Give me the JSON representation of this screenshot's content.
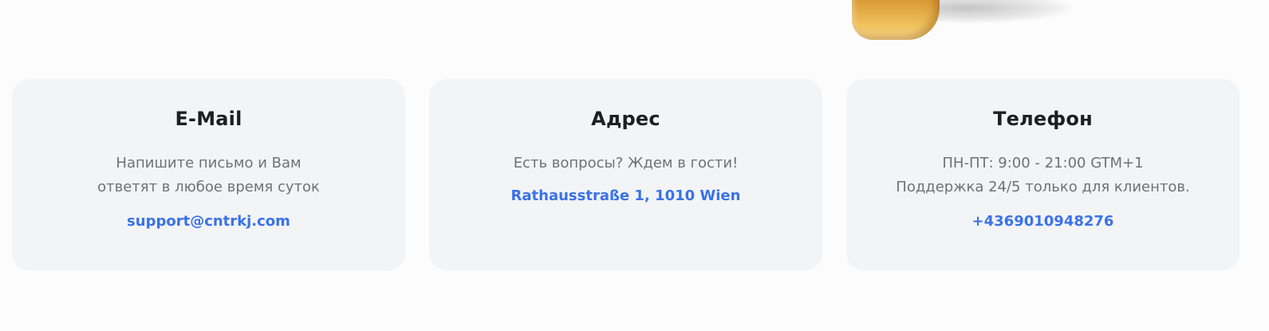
{
  "contacts": [
    {
      "title": "E-Mail",
      "lines": [
        "Напишите письмо и Вам",
        "ответят в любое время суток"
      ],
      "link": "support@cntrkj.com"
    },
    {
      "title": "Адрес",
      "lines": [
        "Есть вопросы? Ждем в гости!"
      ],
      "link": "Rathausstraße 1, 1010 Wien"
    },
    {
      "title": "Телефон",
      "lines": [
        "ПН-ПТ: 9:00 - 21:00 GTM+1",
        "Поддержка 24/5 только для клиентов."
      ],
      "link": "+4369010948276"
    }
  ],
  "colors": {
    "page_background": "#fcfcfc",
    "card_background": "#f3f4f6",
    "title": "#1c1e24",
    "text": "#6f7177",
    "link": "#3a72e8"
  },
  "icons": {
    "hero": "decorative-3d-gold-shape"
  }
}
